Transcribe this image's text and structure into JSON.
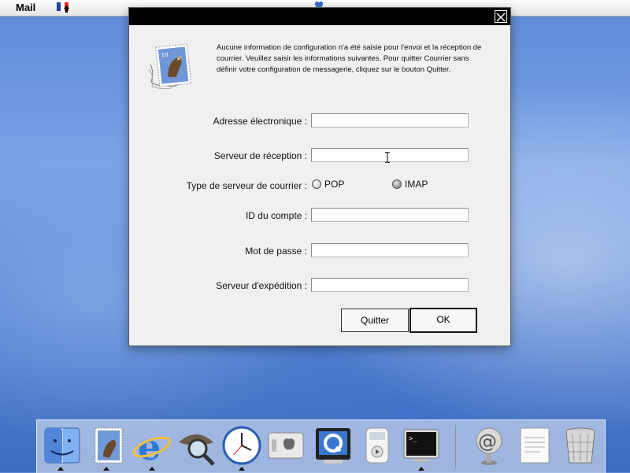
{
  "menubar": {
    "app_name": "Mail"
  },
  "dialog": {
    "message": "Aucune information de configuration n'a été saisie pour l'envoi et la réception de courrier. Veuillez saisir les informations suivantes. Pour quitter Courrier sans définir votre configuration de messagerie, cliquez sur le bouton Quitter.",
    "fields": {
      "email_label": "Adresse électronique :",
      "email_value": "",
      "incoming_label": "Serveur de réception :",
      "incoming_value": "",
      "server_type_label": "Type de serveur de courrier :",
      "pop_label": "POP",
      "imap_label": "IMAP",
      "account_id_label": "ID du compte :",
      "account_id_value": "",
      "password_label": "Mot de passe :",
      "password_value": "",
      "outgoing_label": "Serveur d'expédition :",
      "outgoing_value": ""
    },
    "buttons": {
      "quit_label": "Quitter",
      "ok_label": "OK"
    }
  },
  "dock": {
    "items": [
      "finder-icon",
      "mail-icon",
      "internet-explorer-icon",
      "sherlock-icon",
      "clock-icon",
      "system-preferences-icon",
      "quicktime-icon",
      "itunes-icon",
      "terminal-icon",
      "at-sign-icon",
      "read-me-icon",
      "trash-icon"
    ]
  },
  "colors": {
    "desktop": "#5d8ad6",
    "dialog_bg": "#f1eff0",
    "titlebar": "#000000"
  }
}
